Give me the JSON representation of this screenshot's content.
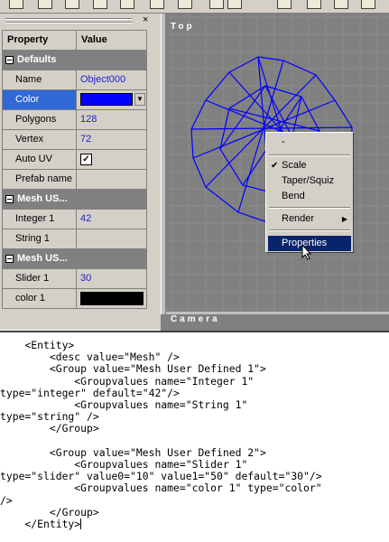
{
  "property_grid": {
    "header": {
      "property": "Property",
      "value": "Value"
    },
    "groups": [
      {
        "title": "Defaults",
        "rows": [
          {
            "name": "Name",
            "value": "Object000"
          },
          {
            "name": "Color",
            "value": "",
            "swatch": "#0000ff",
            "selected": true
          },
          {
            "name": "Polygons",
            "value": "128"
          },
          {
            "name": "Vertex",
            "value": "72"
          },
          {
            "name": "Auto UV",
            "value": "",
            "checked": true
          },
          {
            "name": "Prefab name",
            "value": ""
          }
        ]
      },
      {
        "title": "Mesh US...",
        "rows": [
          {
            "name": "Integer 1",
            "value": "42"
          },
          {
            "name": "String 1",
            "value": ""
          }
        ]
      },
      {
        "title": "Mesh US...",
        "rows": [
          {
            "name": "Slider 1",
            "value": "30"
          },
          {
            "name": "color 1",
            "value": "",
            "swatch": "#000000"
          }
        ]
      }
    ]
  },
  "viewports": {
    "top_label": "Top",
    "bottom_label": "Camera"
  },
  "context_menu": {
    "items": [
      {
        "type": "item",
        "label": "-"
      },
      {
        "type": "separator"
      },
      {
        "type": "item",
        "label": "Scale",
        "checked": true
      },
      {
        "type": "item",
        "label": "Taper/Squiz"
      },
      {
        "type": "item",
        "label": "Bend"
      },
      {
        "type": "separator"
      },
      {
        "type": "item",
        "label": "Render",
        "submenu": true
      },
      {
        "type": "separator"
      },
      {
        "type": "item",
        "label": "Properties",
        "highlighted": true
      }
    ]
  },
  "editor": {
    "lines": [
      "    <Entity>",
      "        <desc value=\"Mesh\" />",
      "        <Group value=\"Mesh User Defined 1\">",
      "            <Groupvalues name=\"Integer 1\"",
      "type=\"integer\" default=\"42\"/>",
      "            <Groupvalues name=\"String 1\"",
      "type=\"string\" />",
      "        </Group>",
      "",
      "        <Group value=\"Mesh User Defined 2\">",
      "            <Groupvalues name=\"Slider 1\"",
      "type=\"slider\" value0=\"10\" value1=\"50\" default=\"30\"/>",
      "            <Groupvalues name=\"color 1\" type=\"color\"",
      "/>",
      "        </Group>",
      "    </Entity>"
    ]
  },
  "colors": {
    "panel_bg": "#d4d0c8",
    "selection": "#3068d8",
    "menu_highlight": "#0a246a",
    "viewport_bg": "#808080",
    "mesh": "#0000ff"
  }
}
